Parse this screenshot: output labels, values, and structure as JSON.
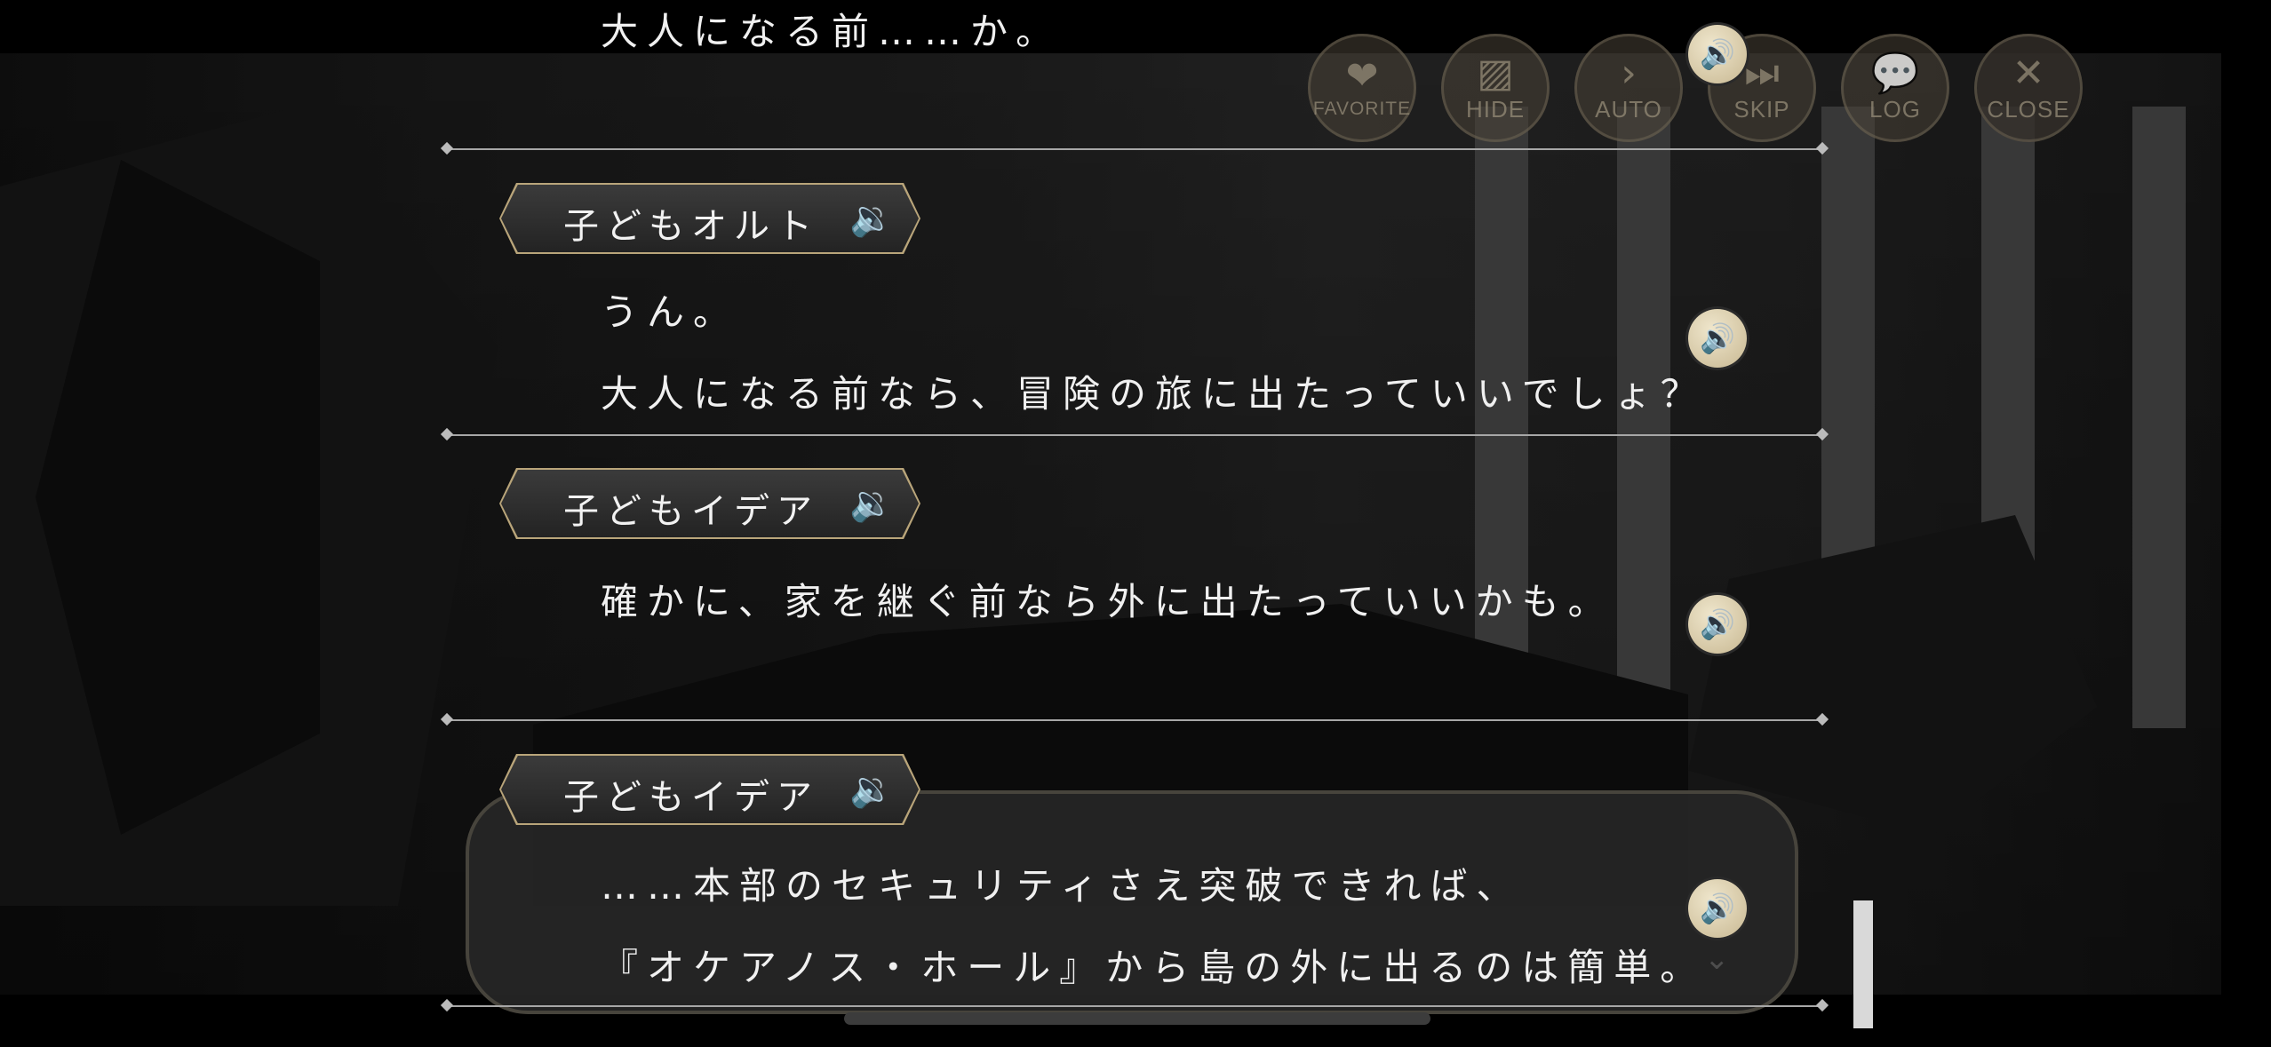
{
  "controls": [
    {
      "label": "FAVORITE",
      "icon": "heart-icon",
      "glyph": "❤"
    },
    {
      "label": "HIDE",
      "icon": "hide-icon",
      "glyph": "▨"
    },
    {
      "label": "AUTO",
      "icon": "auto-play-icon",
      "glyph": "›"
    },
    {
      "label": "SKIP",
      "icon": "skip-icon",
      "glyph": "⏭"
    },
    {
      "label": "LOG",
      "icon": "log-bubble-icon",
      "glyph": "💬"
    },
    {
      "label": "CLOSE",
      "icon": "close-icon",
      "glyph": "✕"
    }
  ],
  "log": {
    "partial_line": "大人になる前……か。",
    "entries": [
      {
        "speaker": "子どもオルト",
        "lines": [
          "うん。",
          "大人になる前なら、冒険の旅に出たっていいでしょ？"
        ]
      },
      {
        "speaker": "子どもイデア",
        "lines": [
          "確かに、家を継ぐ前なら外に出たっていいかも。"
        ]
      },
      {
        "speaker": "子どもイデア",
        "lines": [
          "……本部のセキュリティさえ突破できれば、",
          "『オケアノス・ホール』から島の外に出るのは簡単。"
        ]
      }
    ]
  },
  "icons": {
    "speaker": "speaker-icon",
    "voice": "voice-play-icon",
    "more": "chevron-down-icon"
  },
  "colors": {
    "accent_gold": "#b9a57a",
    "voice_button": "#e6dcc0",
    "background": "#000000"
  }
}
